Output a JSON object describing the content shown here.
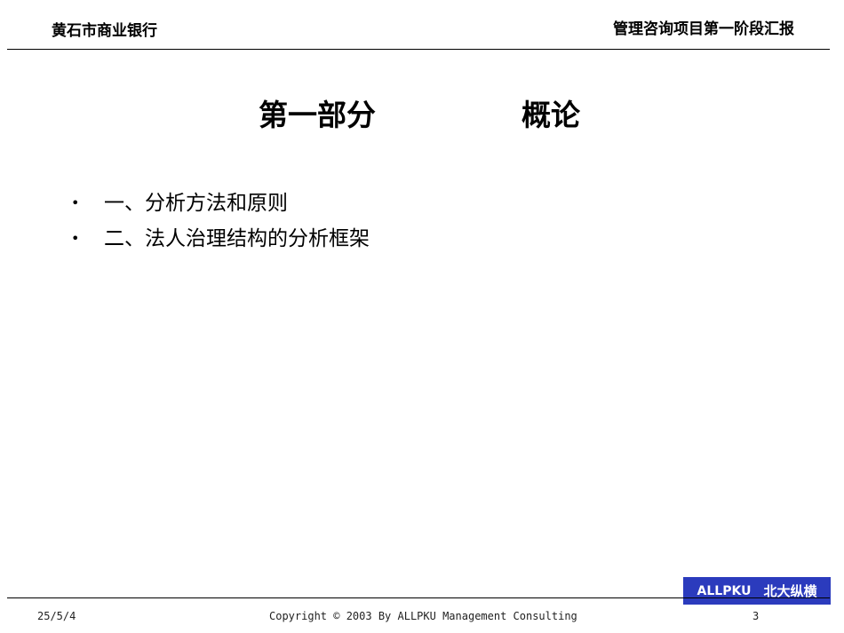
{
  "header": {
    "left": "黄石市商业银行",
    "right": "管理咨询项目第一阶段汇报"
  },
  "title": {
    "part": "第一部分",
    "name": "概论"
  },
  "bullets": [
    "一、分析方法和原则",
    "二、法人治理结构的分析框架"
  ],
  "bullet_symbol": "•",
  "brand": {
    "latin": "ALLPKU",
    "chinese": "北大纵横",
    "color": "#2b3bbd"
  },
  "footer": {
    "date": "25/5/4",
    "copyright": "Copyright © 2003 By ALLPKU Management Consulting",
    "page": "3"
  }
}
